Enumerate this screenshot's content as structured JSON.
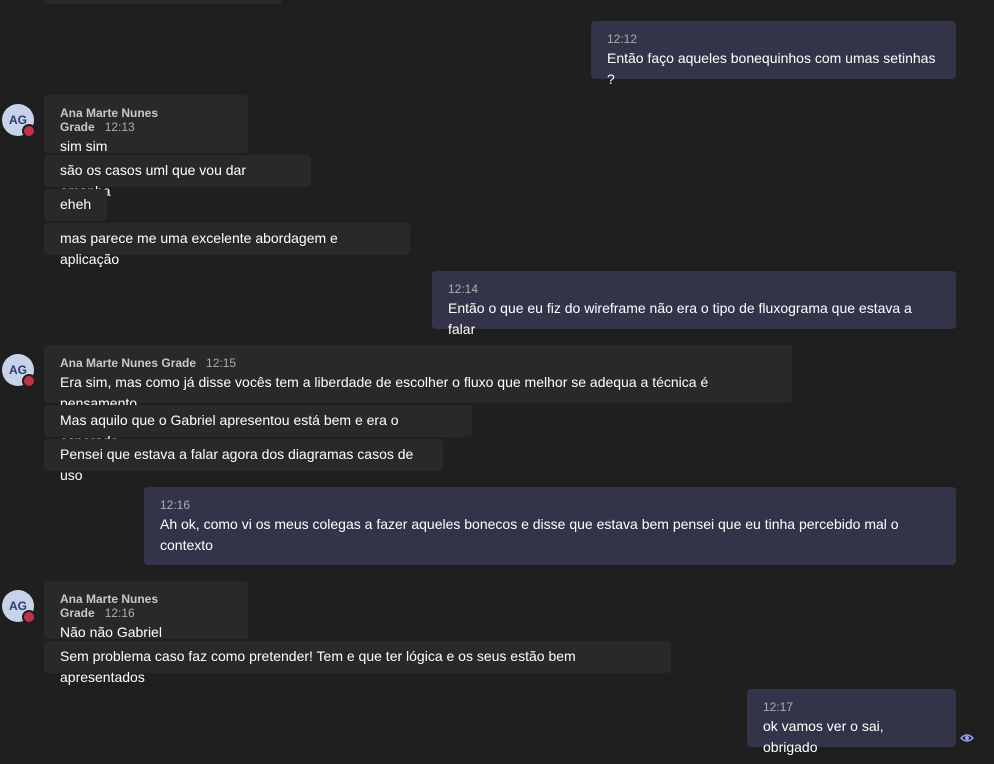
{
  "conversation": {
    "sender": {
      "name": "Ana Marte Nunes Grade",
      "initials": "AG",
      "presence_color": "#c4314b"
    },
    "messages": [
      {
        "time": "12:12",
        "text": "Então faço aqueles bonequinhos com umas setinhas ?"
      },
      {
        "time": "12:13",
        "text": "sim sim"
      },
      {
        "text": "são os casos uml que vou dar amanha"
      },
      {
        "text": "eheh"
      },
      {
        "text": "mas parece me uma excelente abordagem e aplicação"
      },
      {
        "time": "12:14",
        "text": "Então o que eu fiz do wireframe não era o tipo de fluxograma que estava a falar"
      },
      {
        "time": "12:15",
        "text": "Era sim, mas como já disse vocês tem a liberdade de escolher o fluxo que melhor se adequa a técnica é pensamento"
      },
      {
        "text": "Mas aquilo que o Gabriel apresentou está bem e era o esperado"
      },
      {
        "text": "Pensei que estava a falar agora dos diagramas casos de uso"
      },
      {
        "time": "12:16",
        "text": "Ah ok, como vi os meus colegas a fazer aqueles bonecos e disse que estava bem pensei que eu tinha percebido mal o contexto"
      },
      {
        "time": "12:16",
        "text": "Não não Gabriel"
      },
      {
        "text": "Sem problema caso faz como pretender! Tem e que ter lógica e os seus estão bem apresentados"
      },
      {
        "time": "12:17",
        "text": "ok vamos ver o sai, obrigado"
      }
    ],
    "seen_icon": "eye-icon",
    "colors": {
      "background": "#1f1f1f",
      "incoming": "#292929",
      "outgoing": "#33344a"
    }
  }
}
